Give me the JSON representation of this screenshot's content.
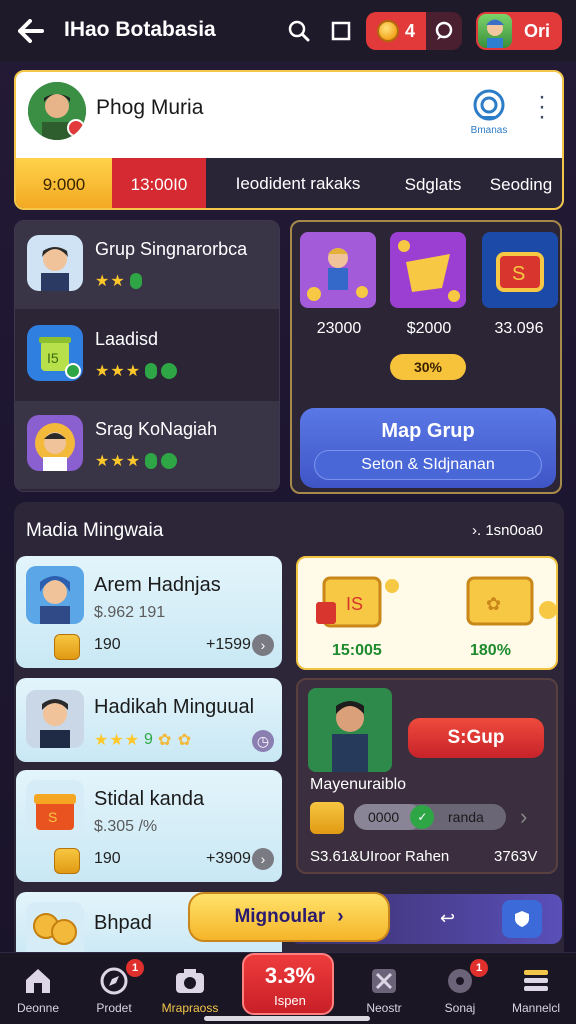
{
  "header": {
    "back_icon": "arrow-left-icon",
    "title": "IHao Botabasia",
    "coins": "4",
    "user_label": "Ori"
  },
  "profile": {
    "name": "Phog Muria",
    "logo_text": "Bmanas",
    "tabs": [
      {
        "label": "9:000"
      },
      {
        "label": "13:00I0"
      },
      {
        "label": "Ieodident rakaks"
      },
      {
        "label": "Sdglats"
      },
      {
        "label": "Seoding"
      }
    ]
  },
  "games": [
    {
      "name": "Grup Singnarorbca",
      "stars": "★★"
    },
    {
      "name": "Laadisd",
      "stars": "★★★"
    },
    {
      "name": "Srag KoNagiah",
      "stars": "★★★"
    }
  ],
  "featured": {
    "prices": [
      "23000",
      "$2000",
      "33.096"
    ],
    "percent": "30%",
    "button_title": "Map Grup",
    "button_sub": "Seton & SIdjnanan"
  },
  "section": {
    "title": "Madia Mingwaia",
    "right": "›. 1sn0oa0",
    "cards": [
      {
        "title": "Arem Hadnjas",
        "price": "$.962 191",
        "num": "190",
        "right": "+1599"
      },
      {
        "title": "Hadikah Minguual",
        "price": "",
        "num": "",
        "right": ""
      },
      {
        "title": "Stidal kanda",
        "price": "$.305 /%",
        "num": "190",
        "right": "+3909"
      },
      {
        "title": "Bhpad",
        "price": "",
        "num": "",
        "right": ""
      }
    ],
    "promo": {
      "left": "15:005",
      "right": "180%"
    },
    "hero": {
      "button": "S:Gup",
      "label": "Mayenuraiblo",
      "progress_text": "0000",
      "progress_after": "randa",
      "progress_fraction": 0.45,
      "foot_left": "S3.61&UIroor Rahen",
      "foot_right": "3763V"
    },
    "cta": "Mignoular"
  },
  "nav": [
    {
      "label": "Deonne",
      "icon": "home-icon"
    },
    {
      "label": "Prodet",
      "icon": "compass-icon",
      "badge": "1"
    },
    {
      "label": "Mrapraoss",
      "icon": "camera-icon"
    },
    {
      "label": "Ispen",
      "value": "3.3%"
    },
    {
      "label": "Neostr",
      "icon": "sword-icon"
    },
    {
      "label": "Sonaj",
      "icon": "disc-icon",
      "badge": "1"
    },
    {
      "label": "Mannelcl",
      "icon": "menu-icon"
    }
  ]
}
